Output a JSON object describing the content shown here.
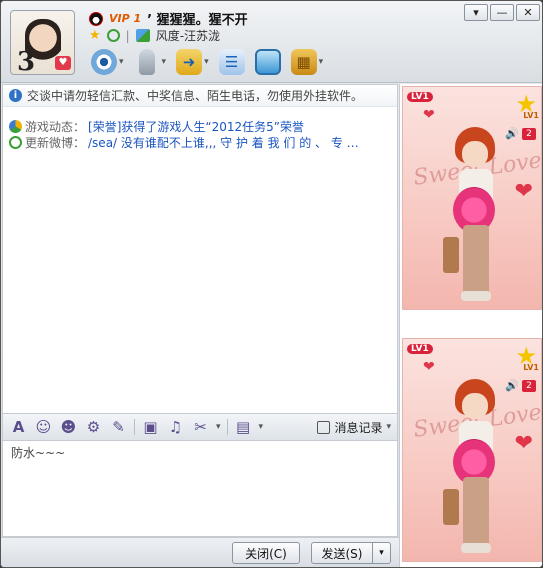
{
  "header": {
    "vip_badge": "VIP 1",
    "nickname": "’ 猩猩猩。猩不开",
    "status_text": "风度-汪苏泷",
    "avatar_number": "3"
  },
  "window_controls": {
    "menu": "▾",
    "minimize": "—",
    "close": "✕"
  },
  "chat": {
    "notice": "交谈中请勿轻信汇款、中奖信息、陌生电话，勿使用外挂软件。",
    "feed": [
      {
        "label": "游戏动态：",
        "text": "[荣誉]获得了游戏人生“2012任务5”荣誉"
      },
      {
        "label": "更新微博：",
        "text": "/sea/ 没有谁配不上谁,,, 守 护 着 我 们 的 、 专 …"
      }
    ]
  },
  "format_toolbar": {
    "history_label": "消息记录"
  },
  "input": {
    "value": "防水~~~"
  },
  "buttons": {
    "close": "关闭(C)",
    "send": "发送(S)"
  },
  "show_panel": {
    "lv_badge": "LV1",
    "lv_small": "LV1",
    "count": "2",
    "watermark": "Sweet Love"
  }
}
